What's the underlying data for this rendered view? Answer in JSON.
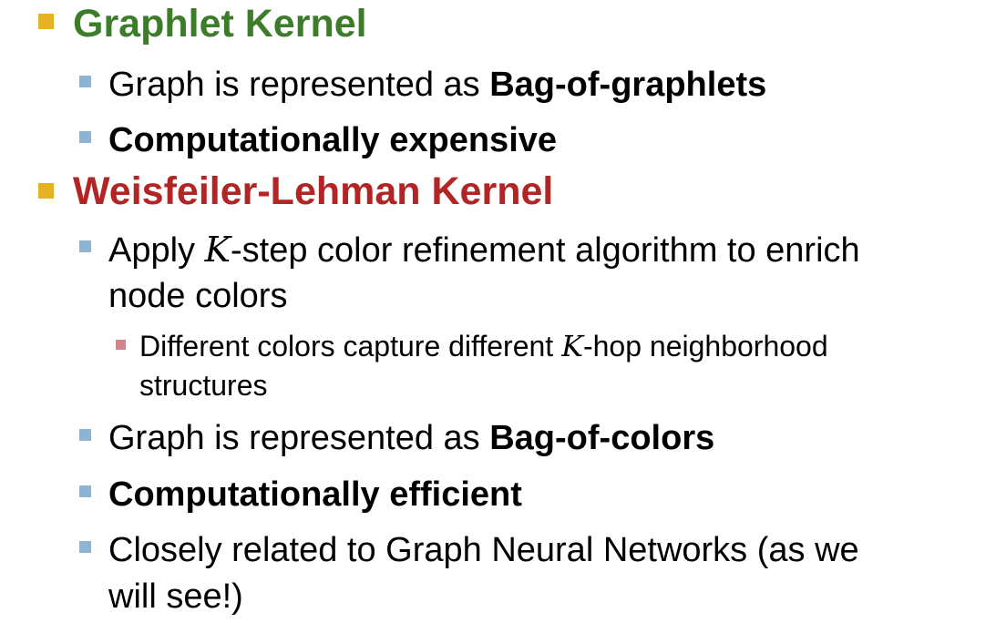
{
  "colors": {
    "l1_bullet": "#E6B222",
    "l2_bullet": "#8DB5D3",
    "l3_bullet": "#D9818B",
    "graphlet_heading": "#3C7D2A",
    "wl_heading": "#B32424"
  },
  "sections": [
    {
      "heading": "Graphlet Kernel",
      "items": [
        {
          "plain": "Graph is represented as ",
          "bold": "Bag-of-graphlets"
        },
        {
          "bold": "Computationally expensive"
        }
      ]
    },
    {
      "heading": "Weisfeiler-Lehman Kernel",
      "items": [
        {
          "pre": "Apply ",
          "math": "K",
          "post": "-step color refinement algorithm to enrich",
          "cont": "node colors",
          "sub": {
            "pre": "Different colors capture different ",
            "math": "K",
            "post": "-hop neighborhood",
            "cont": "structures"
          }
        },
        {
          "plain": "Graph is represented as ",
          "bold": "Bag-of-colors"
        },
        {
          "bold": "Computationally efficient"
        },
        {
          "plain": "Closely related to Graph Neural Networks (as we",
          "cont": "will see!)"
        }
      ]
    }
  ]
}
